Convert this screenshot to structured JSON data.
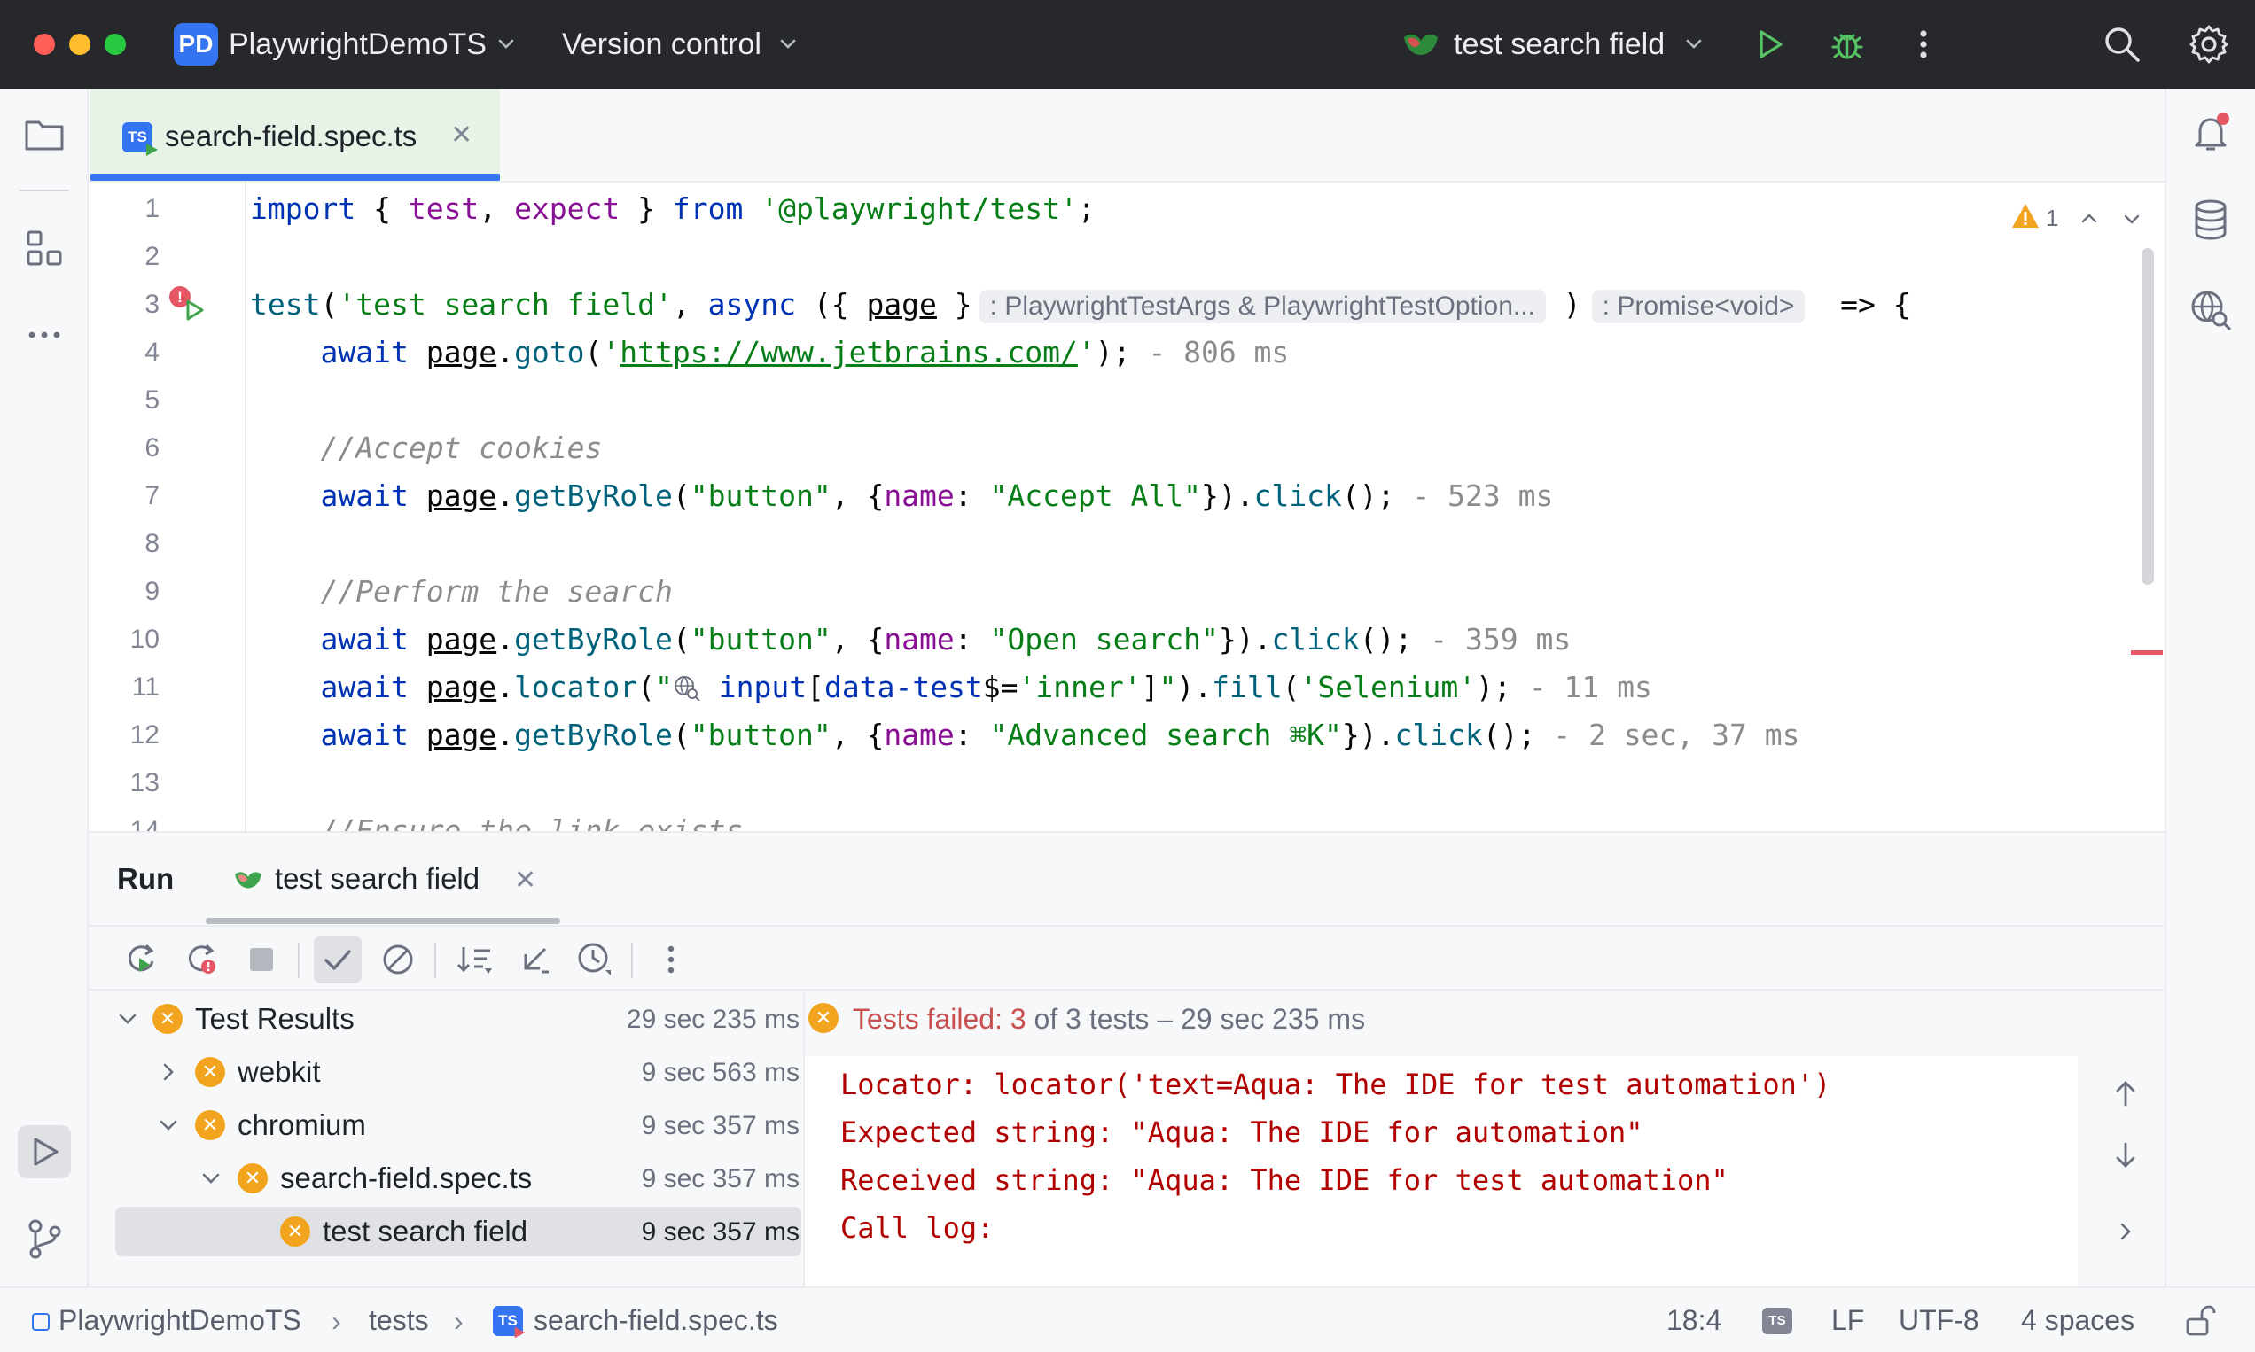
{
  "window": {
    "project_badge": "PD",
    "project_name": "PlaywrightDemoTS",
    "vcs_menu": "Version control",
    "run_config": "test search field"
  },
  "editor": {
    "tab": {
      "label": "search-field.spec.ts",
      "badge": "TS"
    },
    "warning_count": "1",
    "line_numbers": [
      "1",
      "2",
      "3",
      "4",
      "5",
      "6",
      "7",
      "8",
      "9",
      "10",
      "11",
      "12",
      "13",
      "14"
    ],
    "inlay": {
      "page_type": ": PlaywrightTestArgs & PlaywrightTestOption...",
      "return_type": ": Promise<void>"
    },
    "hints": {
      "l4": " - 806 ms",
      "l7": " - 523 ms",
      "l10": " - 359 ms",
      "l11": " - 11 ms",
      "l12": " - 2 sec, 37 ms"
    },
    "comments": {
      "l6": "//Accept cookies",
      "l9": "//Perform the search",
      "l14": "//Ensure the link exists"
    }
  },
  "run_panel": {
    "title": "Run",
    "tab_label": "test search field",
    "tree": [
      {
        "label": "Test Results",
        "time": "29 sec 235 ms"
      },
      {
        "label": "webkit",
        "time": "9 sec 563 ms"
      },
      {
        "label": "chromium",
        "time": "9 sec 357 ms"
      },
      {
        "label": "search-field.spec.ts",
        "time": "9 sec 357 ms"
      },
      {
        "label": "test search field",
        "time": "9 sec 357 ms"
      }
    ],
    "summary": {
      "prefix": "Tests failed: ",
      "failed": "3",
      "rest": " of 3 tests – 29 sec 235 ms"
    },
    "output": [
      "Locator: locator('text=Aqua: The IDE for test automation')",
      "Expected string: \"Aqua: The IDE for automation\"",
      "Received string: \"Aqua: The IDE for test automation\"",
      "Call log:"
    ]
  },
  "statusbar": {
    "project": "PlaywrightDemoTS",
    "folder": "tests",
    "file": "search-field.spec.ts",
    "position": "18:4",
    "line_sep": "LF",
    "encoding": "UTF-8",
    "indent": "4 spaces",
    "ts_badge": "TS"
  },
  "colors": {
    "accent": "#3574f0",
    "fail": "#f2a41f",
    "error_text": "#b00000",
    "run_green": "#3fa34d"
  },
  "icons": [
    "folder-icon",
    "structure-icon",
    "more-icon",
    "run-tool-icon",
    "git-icon",
    "notifications-icon",
    "database-icon",
    "web-inspector-icon",
    "search-icon",
    "settings-icon",
    "run-icon",
    "debug-icon",
    "rerun-icon",
    "rerun-failed-icon",
    "stop-icon",
    "show-passed-icon",
    "show-ignored-icon",
    "sort-icon",
    "collapse-icon",
    "history-icon",
    "lock-icon"
  ]
}
